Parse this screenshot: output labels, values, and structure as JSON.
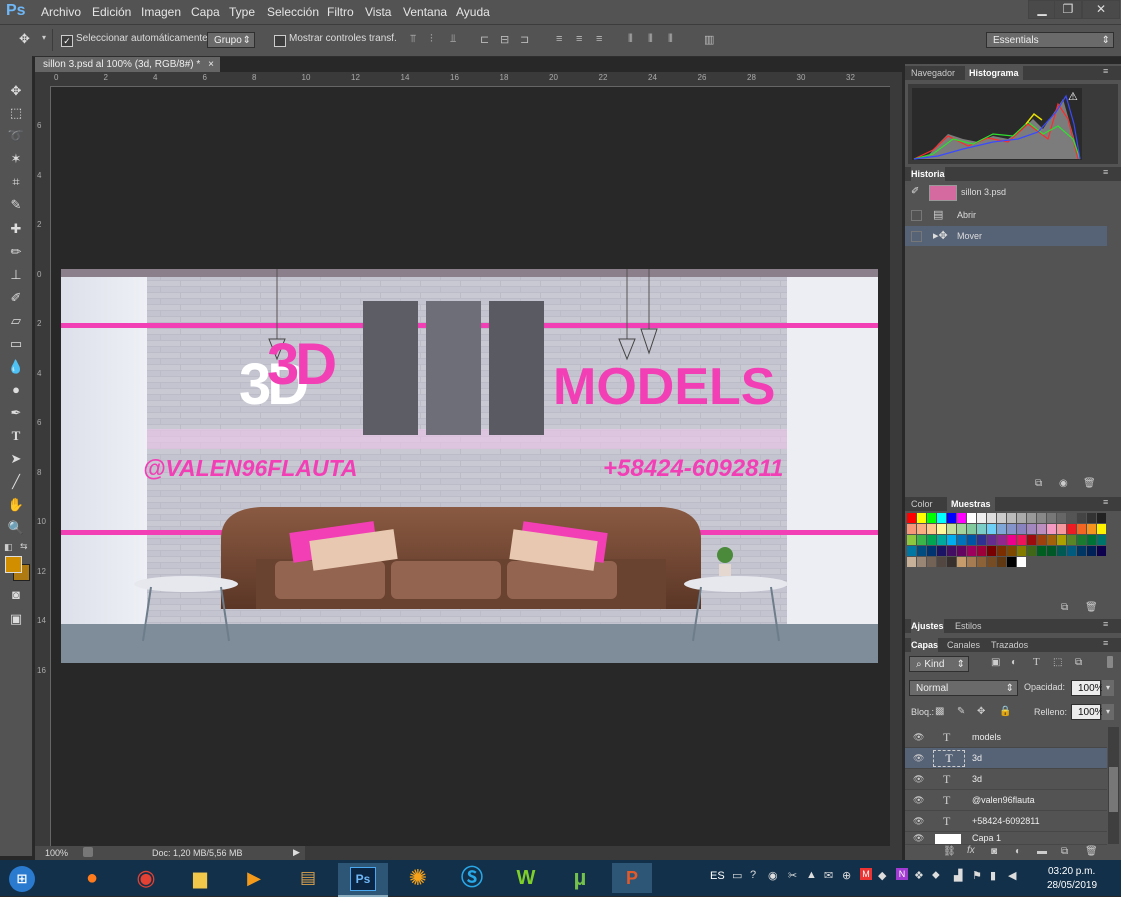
{
  "app": {
    "logo": "Ps"
  },
  "menu": [
    "Archivo",
    "Edición",
    "Imagen",
    "Capa",
    "Type",
    "Selección",
    "Filtro",
    "Vista",
    "Ventana",
    "Ayuda"
  ],
  "options": {
    "auto_select_label": "Seleccionar automáticamente:",
    "auto_select_value": "Grupo",
    "show_transform_label": "Mostrar controles transf.",
    "workspace": "Essentials"
  },
  "document": {
    "tab_title": "sillon 3.psd al 100% (3d, RGB/8#) *",
    "zoom": "100%",
    "doc_info": "Doc: 1,20 MB/5,56 MB",
    "ruler_top": [
      "0",
      "2",
      "4",
      "6",
      "8",
      "10",
      "12",
      "14",
      "16",
      "18",
      "20",
      "22",
      "24",
      "26",
      "28",
      "30",
      "32"
    ],
    "ruler_left": [
      "6",
      "4",
      "2",
      "0",
      "2",
      "4",
      "6",
      "8",
      "10",
      "12",
      "14",
      "16"
    ]
  },
  "artwork": {
    "title_3d": "3D",
    "title_models": "MODELS",
    "handle": "@VALEN96FLAUTA",
    "phone": "+58424-6092811"
  },
  "panels": {
    "top_tabs": [
      "Navegador",
      "Histograma"
    ],
    "history_title": "Historia",
    "history_snapshot": "sillon 3.psd",
    "history_items": [
      "Abrir",
      "Mover"
    ],
    "color_tabs": [
      "Color",
      "Muestras"
    ],
    "adjust_tabs": [
      "Ajustes",
      "Estilos"
    ],
    "layer_tabs": [
      "Capas",
      "Canales",
      "Trazados"
    ],
    "kind_label": "Kind",
    "blend_mode": "Normal",
    "opacity_label": "Opacidad:",
    "opacity_value": "100%",
    "lock_label": "Bloq.:",
    "fill_label": "Relleno:",
    "fill_value": "100%",
    "layers": [
      "models",
      "3d",
      "3d",
      "@valen96flauta",
      "+58424-6092811",
      "Capa 1"
    ]
  },
  "taskbar": {
    "lang": "ES",
    "time": "03:20 p.m.",
    "date": "28/05/2019"
  },
  "colors": {
    "accent_pink": "#f23fb5",
    "foreground": "#d18f00",
    "background": "#b07a13",
    "taskbar": "#12304a"
  }
}
